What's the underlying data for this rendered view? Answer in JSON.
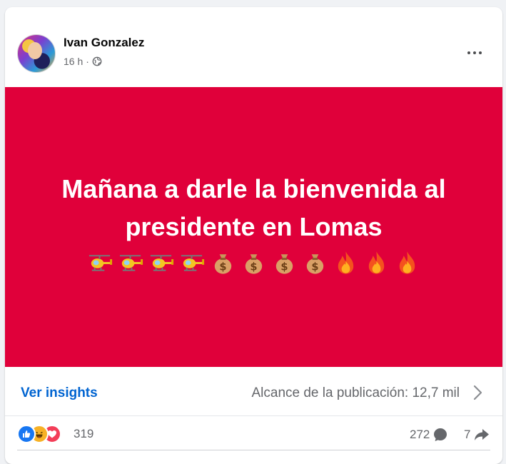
{
  "post": {
    "author": "Ivan Gonzalez",
    "time": "16 h",
    "separator": "·",
    "text_line1": "Mañana a darle la bienvenida al",
    "text_line2": "presidente en Lomas",
    "background_color": "#e0003a",
    "emojis": [
      "helicopter-icon",
      "helicopter-icon",
      "helicopter-icon",
      "helicopter-icon",
      "money-bag-icon",
      "money-bag-icon",
      "money-bag-icon",
      "money-bag-icon",
      "fire-icon",
      "fire-icon",
      "fire-icon"
    ]
  },
  "insights": {
    "link_label": "Ver insights",
    "reach_label": "Alcance de la publicación: 12,7 mil"
  },
  "stats": {
    "reactions_count": "319",
    "comments_count": "272",
    "shares_count": "7"
  }
}
